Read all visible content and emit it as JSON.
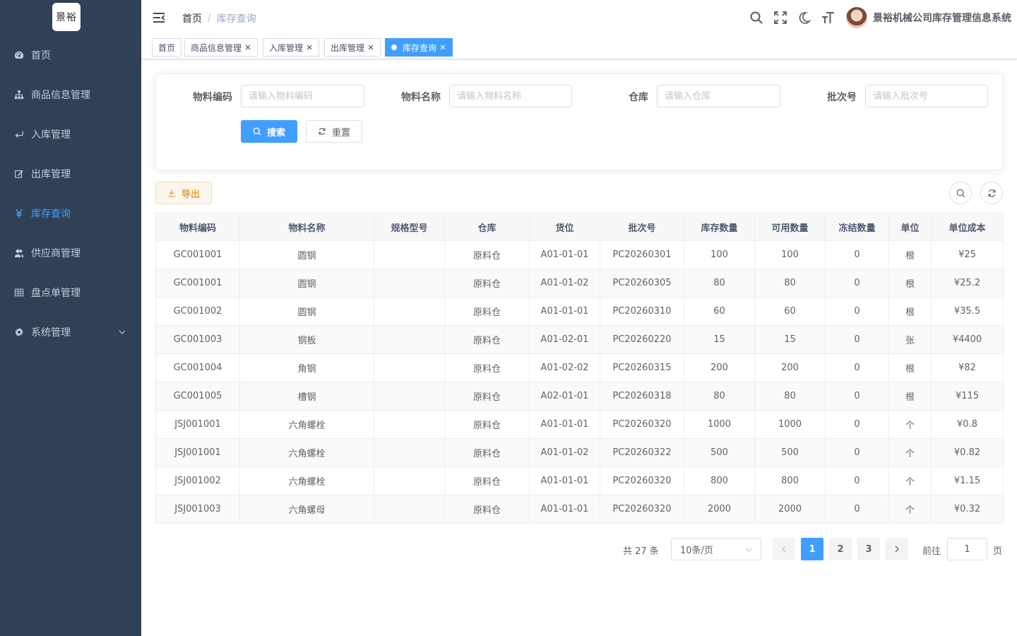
{
  "app": {
    "logo_text": "景裕",
    "system_name": "景裕机械公司库存管理信息系统"
  },
  "sidebar": {
    "items": [
      {
        "label": "首页",
        "icon": "dashboard-icon",
        "active": false
      },
      {
        "label": "商品信息管理",
        "icon": "tree-icon",
        "active": false
      },
      {
        "label": "入库管理",
        "icon": "enter-icon",
        "active": false
      },
      {
        "label": "出库管理",
        "icon": "edit-icon",
        "active": false
      },
      {
        "label": "库存查询",
        "icon": "yen-icon",
        "active": true
      },
      {
        "label": "供应商管理",
        "icon": "peoples-icon",
        "active": false
      },
      {
        "label": "盘点单管理",
        "icon": "table-icon",
        "active": false
      },
      {
        "label": "系统管理",
        "icon": "gear-icon",
        "active": false,
        "has_children": true
      }
    ]
  },
  "breadcrumb": {
    "home": "首页",
    "separator": "/",
    "current": "库存查询"
  },
  "tags": [
    {
      "label": "首页",
      "closable": false,
      "active": false
    },
    {
      "label": "商品信息管理",
      "closable": true,
      "active": false
    },
    {
      "label": "入库管理",
      "closable": true,
      "active": false
    },
    {
      "label": "出库管理",
      "closable": true,
      "active": false
    },
    {
      "label": "库存查询",
      "closable": true,
      "active": true
    }
  ],
  "search_form": {
    "material_code": {
      "label": "物料编码",
      "placeholder": "请输入物料编码",
      "value": ""
    },
    "material_name": {
      "label": "物料名称",
      "placeholder": "请输入物料名称",
      "value": ""
    },
    "warehouse": {
      "label": "仓库",
      "placeholder": "请输入仓库",
      "value": ""
    },
    "batch_no": {
      "label": "批次号",
      "placeholder": "请输入批次号",
      "value": ""
    },
    "search_label": "搜索",
    "reset_label": "重置"
  },
  "toolbar": {
    "export_label": "导出"
  },
  "table": {
    "columns": [
      "物料编码",
      "物料名称",
      "规格型号",
      "仓库",
      "货位",
      "批次号",
      "库存数量",
      "可用数量",
      "冻结数量",
      "单位",
      "单位成本"
    ],
    "rows": [
      [
        "GC001001",
        "圆钢",
        "",
        "原料仓",
        "A01-01-01",
        "PC20260301",
        "100",
        "100",
        "0",
        "根",
        "¥25"
      ],
      [
        "GC001001",
        "圆钢",
        "",
        "原料仓",
        "A01-01-02",
        "PC20260305",
        "80",
        "80",
        "0",
        "根",
        "¥25.2"
      ],
      [
        "GC001002",
        "圆钢",
        "",
        "原料仓",
        "A01-01-01",
        "PC20260310",
        "60",
        "60",
        "0",
        "根",
        "¥35.5"
      ],
      [
        "GC001003",
        "钢板",
        "",
        "原料仓",
        "A01-02-01",
        "PC20260220",
        "15",
        "15",
        "0",
        "张",
        "¥4400"
      ],
      [
        "GC001004",
        "角钢",
        "",
        "原料仓",
        "A01-02-02",
        "PC20260315",
        "200",
        "200",
        "0",
        "根",
        "¥82"
      ],
      [
        "GC001005",
        "槽钢",
        "",
        "原料仓",
        "A02-01-01",
        "PC20260318",
        "80",
        "80",
        "0",
        "根",
        "¥115"
      ],
      [
        "JSJ001001",
        "六角螺栓",
        "",
        "原料仓",
        "A01-01-01",
        "PC20260320",
        "1000",
        "1000",
        "0",
        "个",
        "¥0.8"
      ],
      [
        "JSJ001001",
        "六角螺栓",
        "",
        "原料仓",
        "A01-01-02",
        "PC20260322",
        "500",
        "500",
        "0",
        "个",
        "¥0.82"
      ],
      [
        "JSJ001002",
        "六角螺栓",
        "",
        "原料仓",
        "A01-01-01",
        "PC20260320",
        "800",
        "800",
        "0",
        "个",
        "¥1.15"
      ],
      [
        "JSJ001003",
        "六角螺母",
        "",
        "原料仓",
        "A01-01-01",
        "PC20260320",
        "2000",
        "2000",
        "0",
        "个",
        "¥0.32"
      ]
    ]
  },
  "pagination": {
    "total_text": "共 27 条",
    "page_size": "10条/页",
    "pages": [
      "1",
      "2",
      "3"
    ],
    "current_page": "1",
    "goto_label": "前往",
    "goto_value": "1",
    "page_suffix": "页"
  },
  "colors": {
    "sidebar_bg": "#304156",
    "primary": "#409eff",
    "warning": "#e6a23c"
  }
}
